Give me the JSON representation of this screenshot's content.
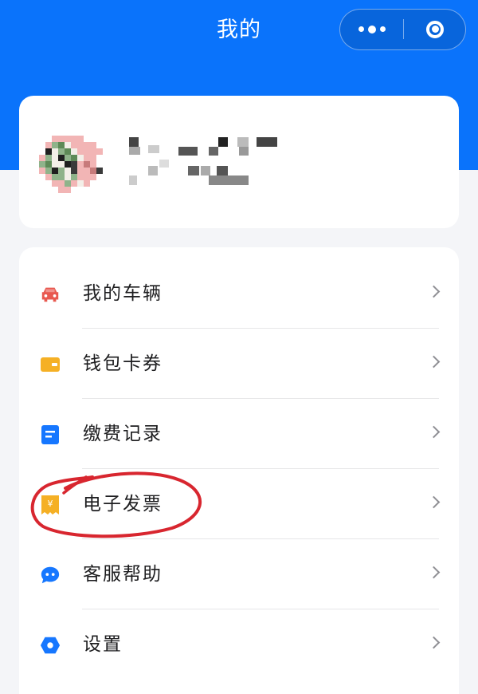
{
  "header": {
    "title": "我的",
    "accent_color": "#0a73fb",
    "capsule": {
      "more_icon": "more-dots-icon",
      "close_icon": "mini-program-close-icon"
    }
  },
  "profile": {
    "avatar_icon": "avatar",
    "name_obscured": true
  },
  "menu": {
    "items": [
      {
        "label": "我的车辆",
        "icon": "car-icon",
        "icon_color": "#e8584f"
      },
      {
        "label": "钱包卡券",
        "icon": "wallet-icon",
        "icon_color": "#f5b025"
      },
      {
        "label": "缴费记录",
        "icon": "document-icon",
        "icon_color": "#1677ff"
      },
      {
        "label": "电子发票",
        "icon": "invoice-yen-icon",
        "icon_color": "#f5b025",
        "highlighted": true
      },
      {
        "label": "客服帮助",
        "icon": "chat-bubble-icon",
        "icon_color": "#1677ff"
      },
      {
        "label": "设置",
        "icon": "settings-hexagon-icon",
        "icon_color": "#1677ff"
      }
    ]
  },
  "annotation": {
    "color": "#d8262f",
    "shape": "hand-drawn-circle"
  }
}
